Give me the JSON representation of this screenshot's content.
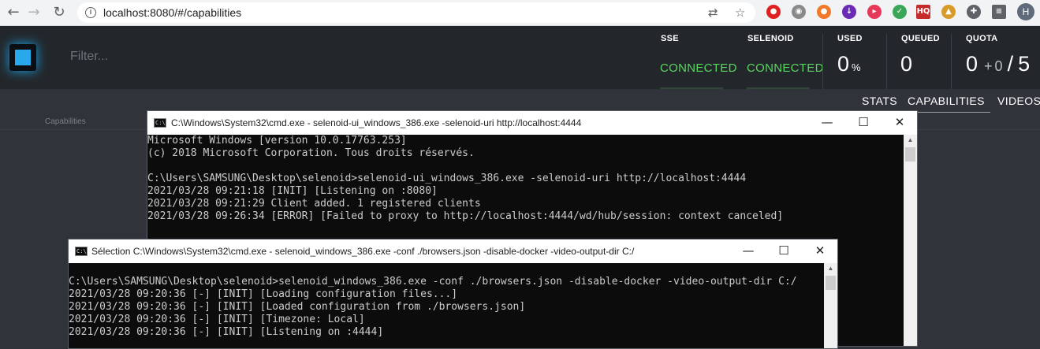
{
  "browser": {
    "url": "localhost:8080/#/capabilities",
    "back": "←",
    "forward": "→",
    "reload": "↻",
    "avatar": "H"
  },
  "header": {
    "filter_placeholder": "Filter...",
    "sse_label": "SSE",
    "sse_status": "CONNECTED",
    "selenoid_label": "SELENOID",
    "selenoid_status": "CONNECTED",
    "used_label": "USED",
    "used_value": "0",
    "used_unit": "%",
    "queued_label": "QUEUED",
    "queued_value": "0",
    "quota_label": "QUOTA",
    "quota_used": "0",
    "quota_plus": "+",
    "quota_pending": "0",
    "quota_sep": "/",
    "quota_total": "5",
    "status_color": "#59d65f"
  },
  "tabs": {
    "stats": "STATS",
    "capabilities": "CAPABILITIES",
    "videos": "VIDEOS",
    "section_label": "Capabilities"
  },
  "window1": {
    "title": "C:\\Windows\\System32\\cmd.exe - selenoid-ui_windows_386.exe  -selenoid-uri http://localhost:4444",
    "lines": [
      "Microsoft Windows [version 10.0.17763.253]",
      "(c) 2018 Microsoft Corporation. Tous droits réservés.",
      "",
      "C:\\Users\\SAMSUNG\\Desktop\\selenoid>selenoid-ui_windows_386.exe -selenoid-uri http://localhost:4444",
      "2021/03/28 09:21:18 [INIT] [Listening on :8080]",
      "2021/03/28 09:21:29 Client added. 1 registered clients",
      "2021/03/28 09:26:34 [ERROR] [Failed to proxy to http://localhost:4444/wd/hub/session: context canceled]"
    ]
  },
  "window2": {
    "title": "Sélection C:\\Windows\\System32\\cmd.exe - selenoid_windows_386.exe  -conf ./browsers.json -disable-docker -video-output-dir C:/",
    "lines": [
      "",
      "C:\\Users\\SAMSUNG\\Desktop\\selenoid>selenoid_windows_386.exe -conf ./browsers.json -disable-docker -video-output-dir C:/",
      "2021/03/28 09:20:36 [-] [INIT] [Loading configuration files...]",
      "2021/03/28 09:20:36 [-] [INIT] [Loaded configuration from ./browsers.json]",
      "2021/03/28 09:20:36 [-] [INIT] [Timezone: Local]",
      "2021/03/28 09:20:36 [-] [INIT] [Listening on :4444]"
    ]
  },
  "window_controls": {
    "minimize": "—",
    "maximize": "☐",
    "close": "✕"
  }
}
